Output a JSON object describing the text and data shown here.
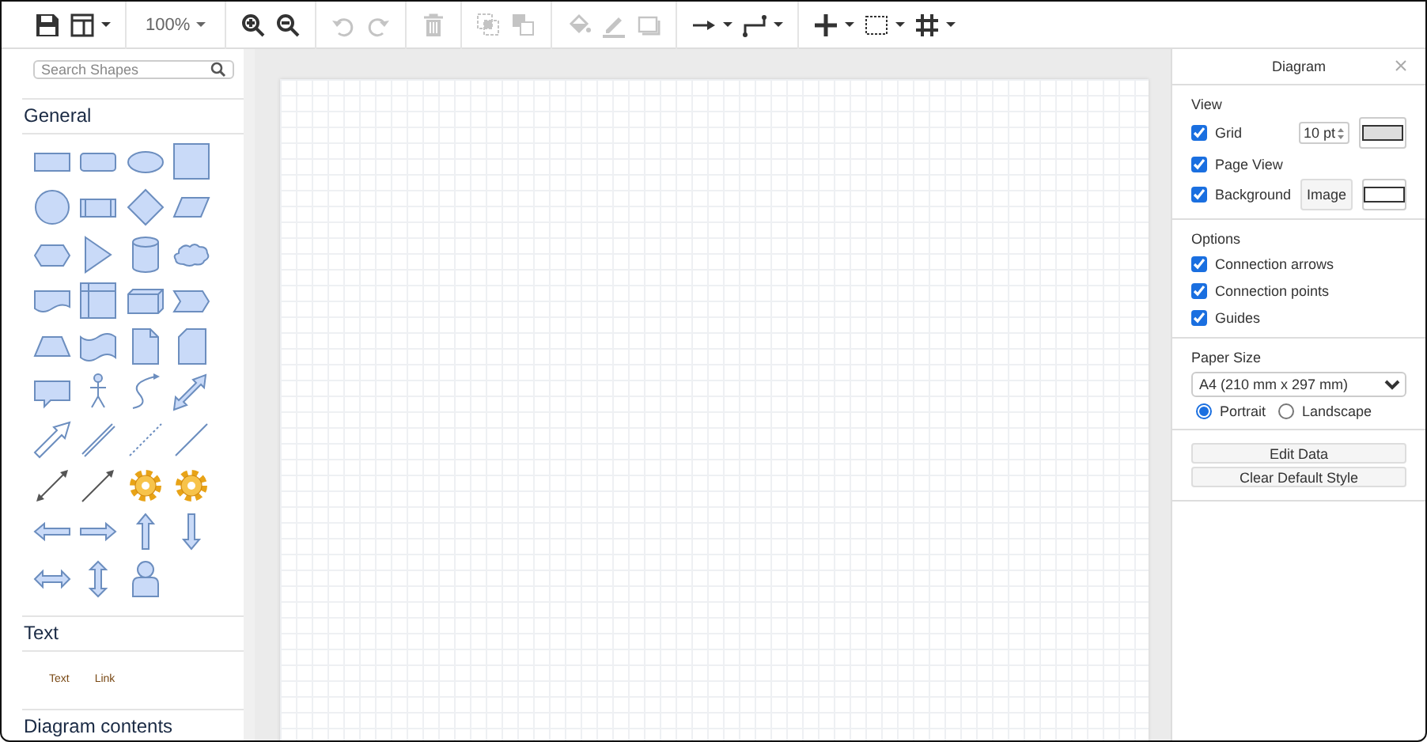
{
  "toolbar": {
    "zoom": "100%",
    "buttons": [
      {
        "disabled": false
      },
      {
        "disabled": false
      },
      {
        "disabled": false
      },
      {
        "disabled": false
      },
      {
        "disabled": true
      },
      {
        "disabled": true
      },
      {
        "disabled": true
      },
      {
        "disabled": true
      },
      {
        "disabled": true
      },
      {
        "disabled": true
      },
      {
        "disabled": true
      },
      {
        "disabled": true
      },
      {
        "disabled": false
      },
      {
        "disabled": false
      },
      {
        "disabled": false
      },
      {
        "disabled": false
      },
      {
        "disabled": false
      }
    ]
  },
  "sidebar": {
    "search": {
      "placeholder": "Search Shapes"
    },
    "sections": [
      {
        "kind": "shapes",
        "title": "General"
      },
      {
        "kind": "text",
        "title": "Text",
        "items": [
          {
            "label": "Text"
          },
          {
            "label": "Link"
          }
        ]
      },
      {
        "kind": "collapsed",
        "title": "Diagram contents"
      }
    ]
  },
  "panel": {
    "title": "Diagram",
    "view": {
      "title": "View",
      "grid": {
        "label": "Grid",
        "checked": true,
        "size": "10 pt"
      },
      "page_view": {
        "label": "Page View",
        "checked": true
      },
      "background": {
        "label": "Background",
        "checked": true,
        "button": "Image"
      }
    },
    "options": {
      "title": "Options",
      "items": [
        {
          "label": "Connection arrows",
          "checked": true
        },
        {
          "label": "Connection points",
          "checked": true
        },
        {
          "label": "Guides",
          "checked": true
        }
      ]
    },
    "paper": {
      "title": "Paper Size",
      "value": "A4 (210 mm x 297 mm)",
      "orientations": [
        {
          "label": "Portrait",
          "selected": true
        },
        {
          "label": "Landscape",
          "selected": false
        }
      ]
    },
    "buttons": [
      "Edit Data",
      "Clear Default Style"
    ]
  }
}
